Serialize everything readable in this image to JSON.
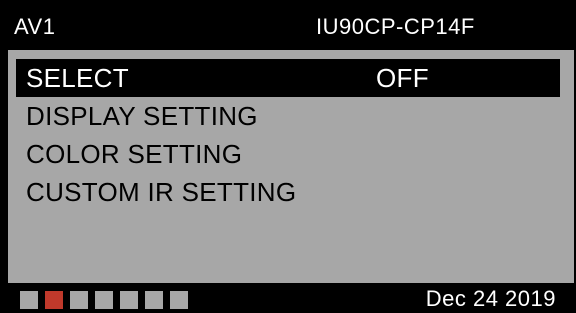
{
  "header": {
    "source": "AV1",
    "model": "IU90CP-CP14F"
  },
  "menu": {
    "items": [
      {
        "label": "SELECT",
        "value": "OFF",
        "selected": true
      },
      {
        "label": "DISPLAY SETTING",
        "value": ""
      },
      {
        "label": "COLOR SETTING",
        "value": ""
      },
      {
        "label": "CUSTOM IR SETTING",
        "value": ""
      }
    ]
  },
  "footer": {
    "page_indicators": [
      false,
      true,
      false,
      false,
      false,
      false,
      false
    ],
    "date": "Dec 24 2019"
  },
  "colors": {
    "panel": "#a7a7a7",
    "active_indicator": "#c0392b",
    "background": "#000000"
  }
}
